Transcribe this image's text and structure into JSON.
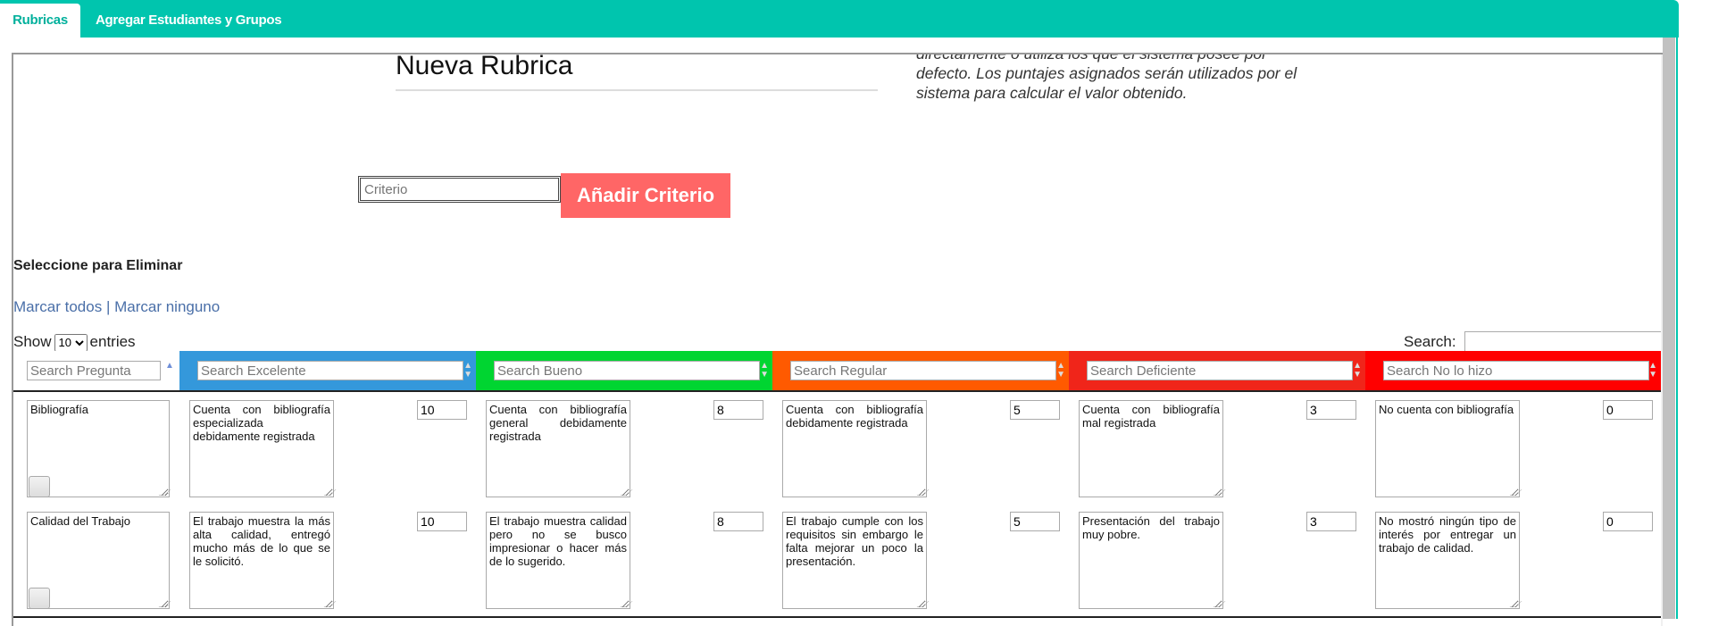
{
  "tabs": [
    {
      "label": "Rubricas",
      "active": true
    },
    {
      "label": "Agregar Estudiantes y Grupos",
      "active": false
    }
  ],
  "page_title": "Nueva Rubrica",
  "description_lines": [
    "directamente o utiliza los que el sistema posee por",
    "defecto. Los puntajes asignados serán utilizados por el",
    "sistema para calcular el valor obtenido."
  ],
  "criterio": {
    "placeholder": "Criterio",
    "value": "",
    "button": "Añadir Criterio",
    "button_color": "#ff6666"
  },
  "select_label": "Seleccione para Eliminar",
  "links": {
    "all": "Marcar todos",
    "separator": "|",
    "none": "Marcar ninguno"
  },
  "length": {
    "show": "Show",
    "value": "10",
    "entries": "entries"
  },
  "search": {
    "label": "Search:",
    "value": ""
  },
  "columns": [
    {
      "key": "pregunta",
      "placeholder": "Search Pregunta",
      "color": "#ffffff"
    },
    {
      "key": "excelente",
      "placeholder": "Search Excelente",
      "color": "#3498db"
    },
    {
      "key": "bueno",
      "placeholder": "Search Bueno",
      "color": "#00d531"
    },
    {
      "key": "regular",
      "placeholder": "Search Regular",
      "color": "#ff5a00"
    },
    {
      "key": "deficiente",
      "placeholder": "Search Deficiente",
      "color": "#f0251a"
    },
    {
      "key": "no_lo_hizo",
      "placeholder": "Search No lo hizo",
      "color": "#ff0000"
    }
  ],
  "rows": [
    {
      "pregunta": "Bibliografía",
      "checked": false,
      "levels": [
        {
          "text": "Cuenta con bibliografía especializada debidamente registrada",
          "score": "10"
        },
        {
          "text": "Cuenta con bibliografía general debidamente registrada",
          "score": "8"
        },
        {
          "text": "Cuenta con bibliografía debidamente registrada",
          "score": "5"
        },
        {
          "text": "Cuenta con bibliografía mal registrada",
          "score": "3"
        },
        {
          "text": "No cuenta con bibliografía",
          "score": "0"
        }
      ]
    },
    {
      "pregunta": "Calidad del Trabajo",
      "checked": false,
      "levels": [
        {
          "text": "El trabajo muestra la más alta calidad, entregó mucho más de lo que se le solicitó.",
          "score": "10"
        },
        {
          "text": "El trabajo muestra calidad pero no se busco impresionar o hacer más de lo sugerido.",
          "score": "8"
        },
        {
          "text": "El trabajo cumple con los requisitos sin embargo le falta mejorar un poco la presentación.",
          "score": "5"
        },
        {
          "text": "Presentación del trabajo muy pobre.",
          "score": "3"
        },
        {
          "text": "No mostró ningún tipo de interés por entregar un trabajo de calidad.",
          "score": "0"
        }
      ]
    }
  ]
}
